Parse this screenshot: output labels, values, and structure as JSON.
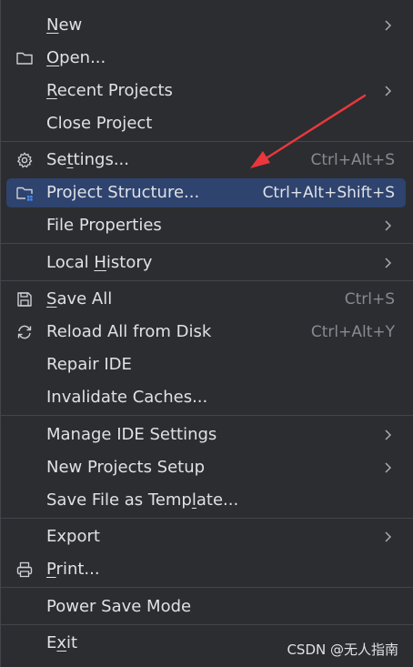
{
  "menu": {
    "items": [
      {
        "label_pre": "",
        "mnemonic": "N",
        "label_post": "ew",
        "shortcut": "",
        "icon": "",
        "submenu": true
      },
      {
        "label_pre": "",
        "mnemonic": "O",
        "label_post": "pen...",
        "shortcut": "",
        "icon": "folder-icon",
        "submenu": false
      },
      {
        "label_pre": "",
        "mnemonic": "R",
        "label_post": "ecent Projects",
        "shortcut": "",
        "icon": "",
        "submenu": true
      },
      {
        "label_pre": "Close Project",
        "mnemonic": "",
        "label_post": "",
        "shortcut": "",
        "icon": "",
        "submenu": false
      },
      {
        "label_pre": "Se",
        "mnemonic": "t",
        "label_post": "tings...",
        "shortcut": "Ctrl+Alt+S",
        "icon": "gear-icon",
        "submenu": false
      },
      {
        "label_pre": "Project Structure...",
        "mnemonic": "",
        "label_post": "",
        "shortcut": "Ctrl+Alt+Shift+S",
        "icon": "project-structure-icon",
        "submenu": false
      },
      {
        "label_pre": "File Properties",
        "mnemonic": "",
        "label_post": "",
        "shortcut": "",
        "icon": "",
        "submenu": true
      },
      {
        "label_pre": "Local ",
        "mnemonic": "H",
        "label_post": "istory",
        "shortcut": "",
        "icon": "",
        "submenu": true
      },
      {
        "label_pre": "",
        "mnemonic": "S",
        "label_post": "ave All",
        "shortcut": "Ctrl+S",
        "icon": "save-icon",
        "submenu": false
      },
      {
        "label_pre": "Reload All from Disk",
        "mnemonic": "",
        "label_post": "",
        "shortcut": "Ctrl+Alt+Y",
        "icon": "reload-icon",
        "submenu": false
      },
      {
        "label_pre": "Repair IDE",
        "mnemonic": "",
        "label_post": "",
        "shortcut": "",
        "icon": "",
        "submenu": false
      },
      {
        "label_pre": "Invalidate Caches...",
        "mnemonic": "",
        "label_post": "",
        "shortcut": "",
        "icon": "",
        "submenu": false
      },
      {
        "label_pre": "Manage IDE Settings",
        "mnemonic": "",
        "label_post": "",
        "shortcut": "",
        "icon": "",
        "submenu": true
      },
      {
        "label_pre": "New Projects Setup",
        "mnemonic": "",
        "label_post": "",
        "shortcut": "",
        "icon": "",
        "submenu": true
      },
      {
        "label_pre": "Save File as Temp",
        "mnemonic": "l",
        "label_post": "ate...",
        "shortcut": "",
        "icon": "",
        "submenu": false
      },
      {
        "label_pre": "Export",
        "mnemonic": "",
        "label_post": "",
        "shortcut": "",
        "icon": "",
        "submenu": true
      },
      {
        "label_pre": "",
        "mnemonic": "P",
        "label_post": "rint...",
        "shortcut": "",
        "icon": "print-icon",
        "submenu": false
      },
      {
        "label_pre": "Power Save Mode",
        "mnemonic": "",
        "label_post": "",
        "shortcut": "",
        "icon": "",
        "submenu": false
      },
      {
        "label_pre": "E",
        "mnemonic": "x",
        "label_post": "it",
        "shortcut": "",
        "icon": "",
        "submenu": false
      }
    ],
    "selected_label": "Project Structure..."
  },
  "colors": {
    "background": "#2b2d30",
    "selection": "#2e436e",
    "text": "#dfe1e5",
    "shortcut": "#868a91",
    "separator": "#43454a",
    "annotation_arrow": "#e8383d"
  },
  "watermark": "CSDN @无人指南"
}
